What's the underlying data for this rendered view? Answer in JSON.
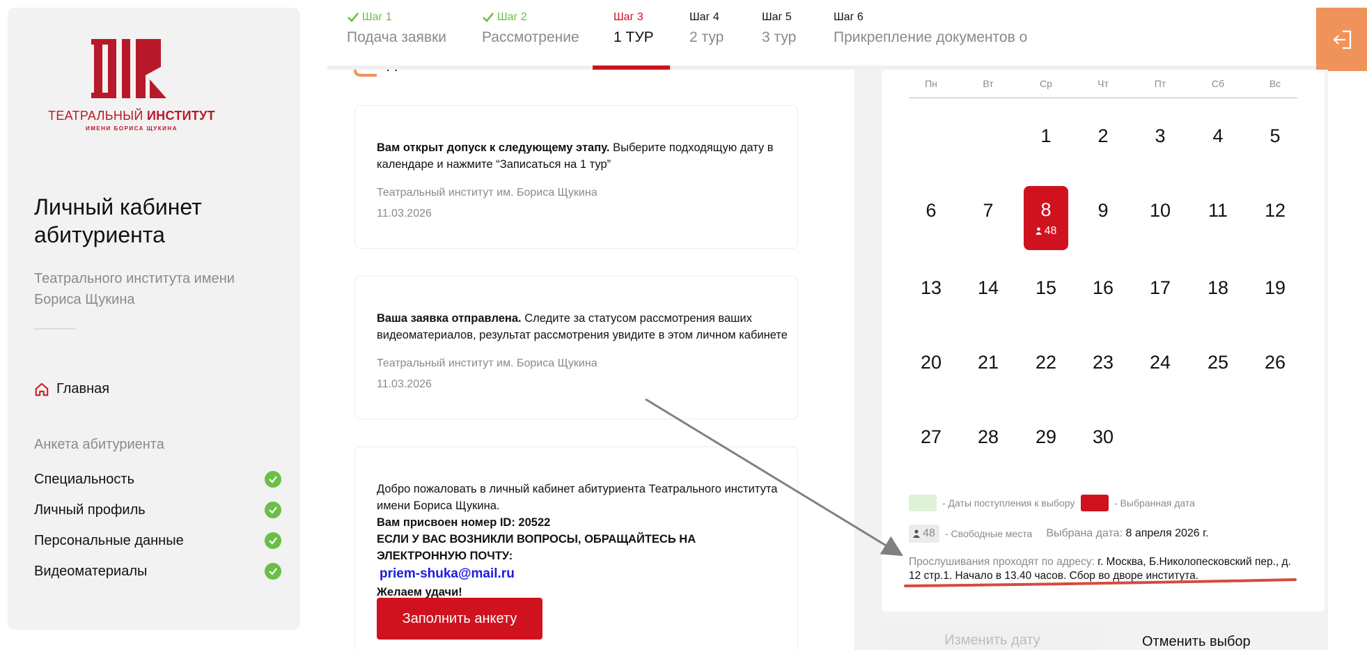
{
  "logo": {
    "name_regular": "ТЕАТРАЛЬНЫЙ ",
    "name_bold": "ИНСТИТУТ",
    "subtitle": "ИМЕНИ БОРИСА ЩУКИНА"
  },
  "sidebar": {
    "title": "Личный кабинет абитуриента",
    "subtitle": "Театрального института имени Бориса Щукина",
    "home_label": "Главная",
    "section_label": "Анкета абитуриента",
    "items": [
      {
        "label": "Специальность"
      },
      {
        "label": "Личный профиль"
      },
      {
        "label": "Персональные данные"
      },
      {
        "label": "Видеоматериалы"
      }
    ]
  },
  "steps": [
    {
      "num": "Шаг 1",
      "name": "Подача заявки",
      "state": "done"
    },
    {
      "num": "Шаг 2",
      "name": "Рассмотрение",
      "state": "done"
    },
    {
      "num": "Шаг 3",
      "name": "1 ТУР",
      "state": "active"
    },
    {
      "num": "Шаг 4",
      "name": "2 тур",
      "state": "pending"
    },
    {
      "num": "Шаг 5",
      "name": "3 тур",
      "state": "pending"
    },
    {
      "num": "Шаг 6",
      "name": "Прикрепление документов о",
      "state": "pending"
    }
  ],
  "feed": {
    "top_text": "д",
    "cards": [
      {
        "bold": "Вам открыт допуск к следующему этапу.",
        "text": " Выберите подходящую дату в календаре и нажмите “Записаться на 1 тур”",
        "org": "Театральный институт им. Бориса Щукина",
        "date": "11.03.2026"
      },
      {
        "bold": "Ваша заявка отправлена.",
        "text": " Следите за статусом рассмотрения ваших видеоматериалов, результат рассмотрения увидите в этом личном кабинете",
        "org": "Театральный институт им. Бориса Щукина",
        "date": "11.03.2026"
      }
    ],
    "welcome": {
      "line1": "Добро пожаловать в личный кабинет абитуриента Театрального института имени Бориса Щукина.",
      "line2": "Вам присвоен номер ID: 20522",
      "line3": "ЕСЛИ У ВАС ВОЗНИКЛИ ВОПРОСЫ, ОБРАЩАЙТЕСЬ НА ЭЛЕКТРОННУЮ ПОЧТУ:",
      "email": "priem-shuka@mail.ru",
      "line4": "Желаем удачи!",
      "button": "Заполнить анкету"
    }
  },
  "calendar": {
    "weekdays": [
      "Пн",
      "Вт",
      "Ср",
      "Чт",
      "Пт",
      "Сб",
      "Вс"
    ],
    "first_weekday_index": 2,
    "days_in_month": 30,
    "selected_day": 8,
    "selected_seats": "48",
    "legend_available": "- Даты поступления к выбору",
    "legend_selected": "- Выбранная дата",
    "seats_value": "48",
    "seats_label": "- Свободные места",
    "chosen_label": "Выбрана дата:",
    "chosen_value": "8 апреля 2026 г.",
    "address_label": "Прослушивания проходят по адресу:",
    "address_value": " г. Москва, Б.Николопесковский пер., д. 12 стр.1. Начало в 13.40 часов. Сбор во дворе института.",
    "btn_change": "Изменить дату",
    "btn_cancel": "Отменить выбор",
    "colors": {
      "available": "#dff2d8",
      "selected": "#d0121f"
    }
  }
}
